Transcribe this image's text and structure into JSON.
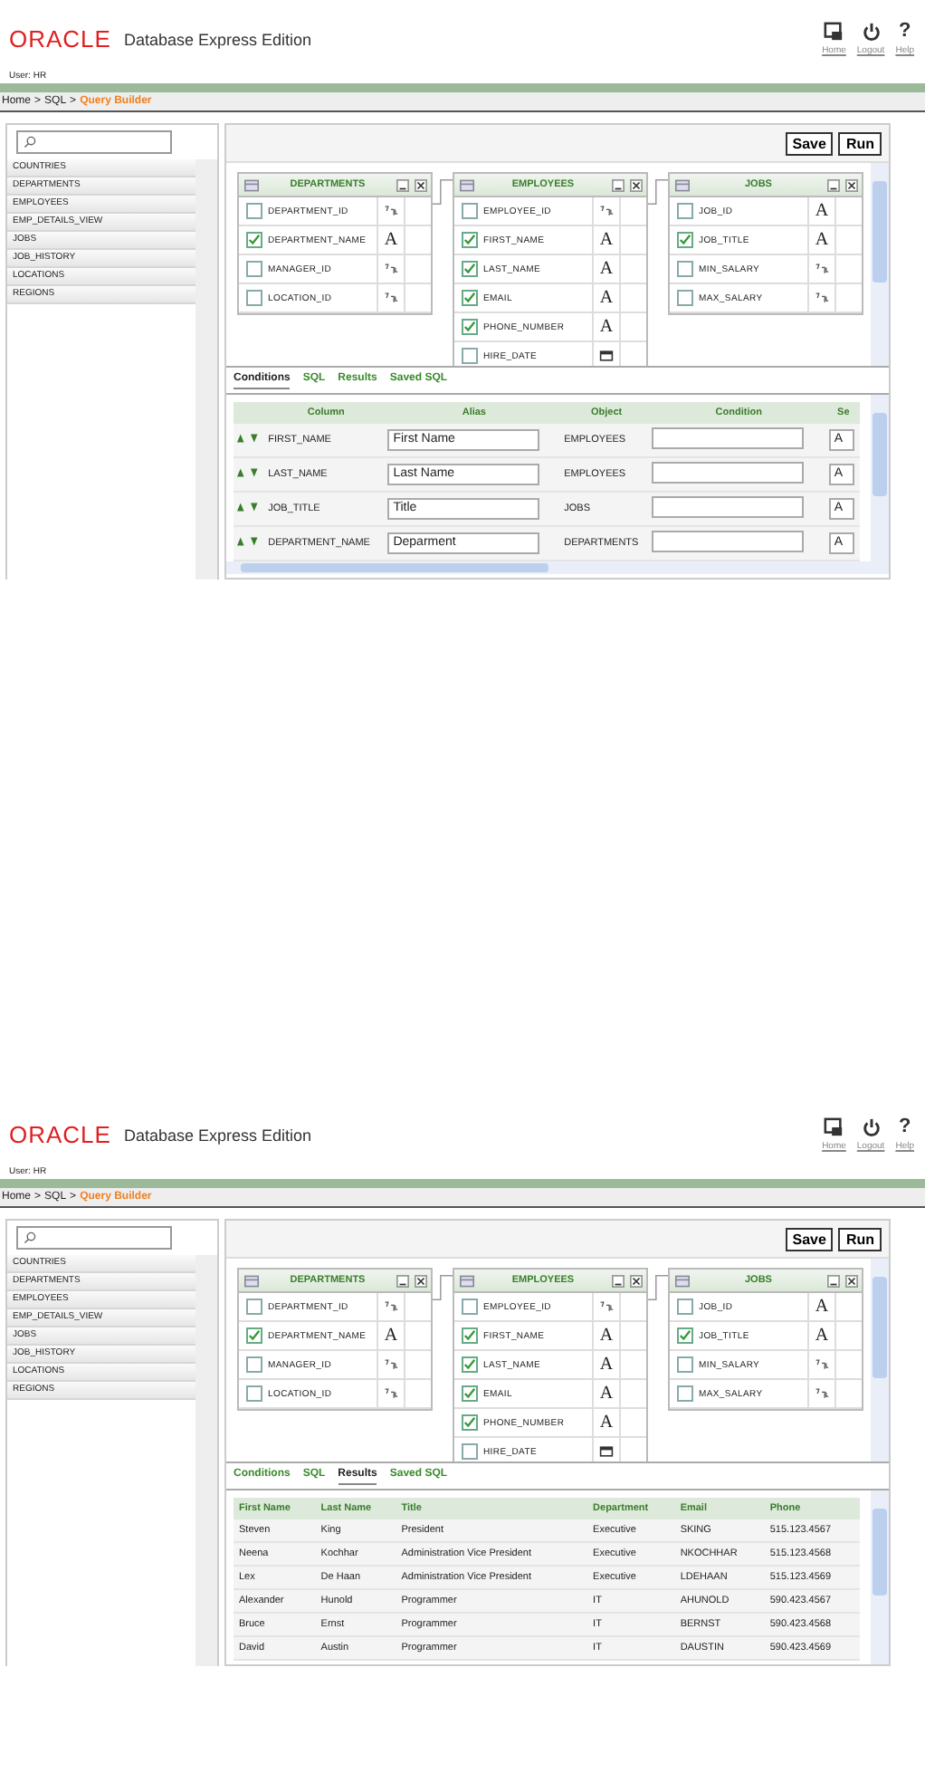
{
  "screens": [
    {
      "brand": {
        "logo": "ORACLE",
        "product": "Database Express Edition"
      },
      "nav": [
        {
          "label": "Home",
          "kind": "home"
        },
        {
          "label": "Logout",
          "kind": "logout"
        },
        {
          "label": "Help",
          "kind": "help",
          "glyph": "?"
        }
      ],
      "user": "User: HR",
      "breadcrumb": [
        "Home",
        ">",
        "SQL",
        ">"
      ],
      "breadcrumb_current": "Query Builder",
      "sidebar": {
        "items": [
          "COUNTRIES",
          "DEPARTMENTS",
          "EMPLOYEES",
          "EMP_DETAILS_VIEW",
          "JOBS",
          "JOB_HISTORY",
          "LOCATIONS",
          "REGIONS"
        ]
      },
      "toolbar": [
        "Save",
        "Run"
      ],
      "tables": [
        {
          "title": "DEPARTMENTS",
          "columns": [
            {
              "name": "DEPARTMENT_ID",
              "checked": false,
              "kind": "number"
            },
            {
              "name": "DEPARTMENT_NAME",
              "checked": true,
              "kind": "text",
              "glyph": "A"
            },
            {
              "name": "MANAGER_ID",
              "checked": false,
              "kind": "number"
            },
            {
              "name": "LOCATION_ID",
              "checked": false,
              "kind": "number"
            }
          ]
        },
        {
          "title": "EMPLOYEES",
          "columns": [
            {
              "name": "EMPLOYEE_ID",
              "checked": false,
              "kind": "number"
            },
            {
              "name": "FIRST_NAME",
              "checked": true,
              "kind": "text",
              "glyph": "A"
            },
            {
              "name": "LAST_NAME",
              "checked": true,
              "kind": "text",
              "glyph": "A"
            },
            {
              "name": "EMAIL",
              "checked": true,
              "kind": "text",
              "glyph": "A"
            },
            {
              "name": "PHONE_NUMBER",
              "checked": true,
              "kind": "text",
              "glyph": "A"
            },
            {
              "name": "HIRE_DATE",
              "checked": false,
              "kind": "date"
            }
          ]
        },
        {
          "title": "JOBS",
          "columns": [
            {
              "name": "JOB_ID",
              "checked": false,
              "kind": "text",
              "glyph": "A"
            },
            {
              "name": "JOB_TITLE",
              "checked": true,
              "kind": "text",
              "glyph": "A"
            },
            {
              "name": "MIN_SALARY",
              "checked": false,
              "kind": "number"
            },
            {
              "name": "MAX_SALARY",
              "checked": false,
              "kind": "number"
            }
          ]
        }
      ],
      "tabs": [
        {
          "label": "Conditions",
          "selected": true
        },
        {
          "label": "SQL",
          "selected": false
        },
        {
          "label": "Results",
          "selected": false
        },
        {
          "label": "Saved SQL",
          "selected": false
        }
      ],
      "lower": {
        "kind": "conditions",
        "columns": [
          "Column",
          "Alias",
          "Object",
          "Condition",
          "Se"
        ],
        "rows": [
          {
            "column": "FIRST_NAME",
            "alias": "First Name",
            "object": "EMPLOYEES",
            "column_5": "A"
          },
          {
            "column": "LAST_NAME",
            "alias": "Last Name",
            "object": "EMPLOYEES",
            "column_5": "A"
          },
          {
            "column": "JOB_TITLE",
            "alias": "Title",
            "object": "JOBS",
            "column_5": "A"
          },
          {
            "column": "DEPARTMENT_NAME",
            "alias": "Deparment",
            "object": "DEPARTMENTS",
            "column_5": "A"
          }
        ]
      }
    },
    {
      "brand": {
        "logo": "ORACLE",
        "product": "Database Express Edition"
      },
      "nav": [
        {
          "label": "Home",
          "kind": "home"
        },
        {
          "label": "Logout",
          "kind": "logout"
        },
        {
          "label": "Help",
          "kind": "help",
          "glyph": "?"
        }
      ],
      "user": "User: HR",
      "breadcrumb": [
        "Home",
        ">",
        "SQL",
        ">"
      ],
      "breadcrumb_current": "Query Builder",
      "sidebar": {
        "items": [
          "COUNTRIES",
          "DEPARTMENTS",
          "EMPLOYEES",
          "EMP_DETAILS_VIEW",
          "JOBS",
          "JOB_HISTORY",
          "LOCATIONS",
          "REGIONS"
        ]
      },
      "toolbar": [
        "Save",
        "Run"
      ],
      "tables": [
        {
          "title": "DEPARTMENTS",
          "columns": [
            {
              "name": "DEPARTMENT_ID",
              "checked": false,
              "kind": "number"
            },
            {
              "name": "DEPARTMENT_NAME",
              "checked": true,
              "kind": "text",
              "glyph": "A"
            },
            {
              "name": "MANAGER_ID",
              "checked": false,
              "kind": "number"
            },
            {
              "name": "LOCATION_ID",
              "checked": false,
              "kind": "number"
            }
          ]
        },
        {
          "title": "EMPLOYEES",
          "columns": [
            {
              "name": "EMPLOYEE_ID",
              "checked": false,
              "kind": "number"
            },
            {
              "name": "FIRST_NAME",
              "checked": true,
              "kind": "text",
              "glyph": "A"
            },
            {
              "name": "LAST_NAME",
              "checked": true,
              "kind": "text",
              "glyph": "A"
            },
            {
              "name": "EMAIL",
              "checked": true,
              "kind": "text",
              "glyph": "A"
            },
            {
              "name": "PHONE_NUMBER",
              "checked": true,
              "kind": "text",
              "glyph": "A"
            },
            {
              "name": "HIRE_DATE",
              "checked": false,
              "kind": "date"
            }
          ]
        },
        {
          "title": "JOBS",
          "columns": [
            {
              "name": "JOB_ID",
              "checked": false,
              "kind": "text",
              "glyph": "A"
            },
            {
              "name": "JOB_TITLE",
              "checked": true,
              "kind": "text",
              "glyph": "A"
            },
            {
              "name": "MIN_SALARY",
              "checked": false,
              "kind": "number"
            },
            {
              "name": "MAX_SALARY",
              "checked": false,
              "kind": "number"
            }
          ]
        }
      ],
      "tabs": [
        {
          "label": "Conditions",
          "selected": false
        },
        {
          "label": "SQL",
          "selected": false
        },
        {
          "label": "Results",
          "selected": true
        },
        {
          "label": "Saved SQL",
          "selected": false
        }
      ],
      "lower": {
        "kind": "results",
        "columns": [
          "First Name",
          "Last Name",
          "Title",
          "Department",
          "Email",
          "Phone"
        ],
        "rows": [
          [
            "Steven",
            "King",
            "President",
            "Executive",
            "SKING",
            "515.123.4567"
          ],
          [
            "Neena",
            "Kochhar",
            "Administration Vice President",
            "Executive",
            "NKOCHHAR",
            "515.123.4568"
          ],
          [
            "Lex",
            "De Haan",
            "Administration Vice President",
            "Executive",
            "LDEHAAN",
            "515.123.4569"
          ],
          [
            "Alexander",
            "Hunold",
            "Programmer",
            "IT",
            "AHUNOLD",
            "590.423.4567"
          ],
          [
            "Bruce",
            "Ernst",
            "Programmer",
            "IT",
            "BERNST",
            "590.423.4568"
          ],
          [
            "David",
            "Austin",
            "Programmer",
            "IT",
            "DAUSTIN",
            "590.423.4569"
          ]
        ]
      }
    }
  ]
}
